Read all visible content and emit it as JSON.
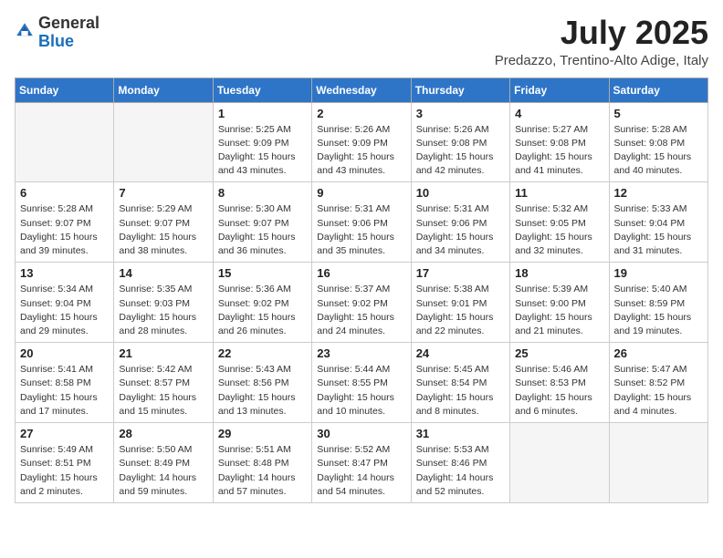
{
  "header": {
    "logo_general": "General",
    "logo_blue": "Blue",
    "title": "July 2025",
    "subtitle": "Predazzo, Trentino-Alto Adige, Italy"
  },
  "days_of_week": [
    "Sunday",
    "Monday",
    "Tuesday",
    "Wednesday",
    "Thursday",
    "Friday",
    "Saturday"
  ],
  "weeks": [
    [
      {
        "day": "",
        "empty": true
      },
      {
        "day": "",
        "empty": true
      },
      {
        "day": "1",
        "sunrise": "5:25 AM",
        "sunset": "9:09 PM",
        "daylight": "15 hours and 43 minutes."
      },
      {
        "day": "2",
        "sunrise": "5:26 AM",
        "sunset": "9:09 PM",
        "daylight": "15 hours and 43 minutes."
      },
      {
        "day": "3",
        "sunrise": "5:26 AM",
        "sunset": "9:08 PM",
        "daylight": "15 hours and 42 minutes."
      },
      {
        "day": "4",
        "sunrise": "5:27 AM",
        "sunset": "9:08 PM",
        "daylight": "15 hours and 41 minutes."
      },
      {
        "day": "5",
        "sunrise": "5:28 AM",
        "sunset": "9:08 PM",
        "daylight": "15 hours and 40 minutes."
      }
    ],
    [
      {
        "day": "6",
        "sunrise": "5:28 AM",
        "sunset": "9:07 PM",
        "daylight": "15 hours and 39 minutes."
      },
      {
        "day": "7",
        "sunrise": "5:29 AM",
        "sunset": "9:07 PM",
        "daylight": "15 hours and 38 minutes."
      },
      {
        "day": "8",
        "sunrise": "5:30 AM",
        "sunset": "9:07 PM",
        "daylight": "15 hours and 36 minutes."
      },
      {
        "day": "9",
        "sunrise": "5:31 AM",
        "sunset": "9:06 PM",
        "daylight": "15 hours and 35 minutes."
      },
      {
        "day": "10",
        "sunrise": "5:31 AM",
        "sunset": "9:06 PM",
        "daylight": "15 hours and 34 minutes."
      },
      {
        "day": "11",
        "sunrise": "5:32 AM",
        "sunset": "9:05 PM",
        "daylight": "15 hours and 32 minutes."
      },
      {
        "day": "12",
        "sunrise": "5:33 AM",
        "sunset": "9:04 PM",
        "daylight": "15 hours and 31 minutes."
      }
    ],
    [
      {
        "day": "13",
        "sunrise": "5:34 AM",
        "sunset": "9:04 PM",
        "daylight": "15 hours and 29 minutes."
      },
      {
        "day": "14",
        "sunrise": "5:35 AM",
        "sunset": "9:03 PM",
        "daylight": "15 hours and 28 minutes."
      },
      {
        "day": "15",
        "sunrise": "5:36 AM",
        "sunset": "9:02 PM",
        "daylight": "15 hours and 26 minutes."
      },
      {
        "day": "16",
        "sunrise": "5:37 AM",
        "sunset": "9:02 PM",
        "daylight": "15 hours and 24 minutes."
      },
      {
        "day": "17",
        "sunrise": "5:38 AM",
        "sunset": "9:01 PM",
        "daylight": "15 hours and 22 minutes."
      },
      {
        "day": "18",
        "sunrise": "5:39 AM",
        "sunset": "9:00 PM",
        "daylight": "15 hours and 21 minutes."
      },
      {
        "day": "19",
        "sunrise": "5:40 AM",
        "sunset": "8:59 PM",
        "daylight": "15 hours and 19 minutes."
      }
    ],
    [
      {
        "day": "20",
        "sunrise": "5:41 AM",
        "sunset": "8:58 PM",
        "daylight": "15 hours and 17 minutes."
      },
      {
        "day": "21",
        "sunrise": "5:42 AM",
        "sunset": "8:57 PM",
        "daylight": "15 hours and 15 minutes."
      },
      {
        "day": "22",
        "sunrise": "5:43 AM",
        "sunset": "8:56 PM",
        "daylight": "15 hours and 13 minutes."
      },
      {
        "day": "23",
        "sunrise": "5:44 AM",
        "sunset": "8:55 PM",
        "daylight": "15 hours and 10 minutes."
      },
      {
        "day": "24",
        "sunrise": "5:45 AM",
        "sunset": "8:54 PM",
        "daylight": "15 hours and 8 minutes."
      },
      {
        "day": "25",
        "sunrise": "5:46 AM",
        "sunset": "8:53 PM",
        "daylight": "15 hours and 6 minutes."
      },
      {
        "day": "26",
        "sunrise": "5:47 AM",
        "sunset": "8:52 PM",
        "daylight": "15 hours and 4 minutes."
      }
    ],
    [
      {
        "day": "27",
        "sunrise": "5:49 AM",
        "sunset": "8:51 PM",
        "daylight": "15 hours and 2 minutes."
      },
      {
        "day": "28",
        "sunrise": "5:50 AM",
        "sunset": "8:49 PM",
        "daylight": "14 hours and 59 minutes."
      },
      {
        "day": "29",
        "sunrise": "5:51 AM",
        "sunset": "8:48 PM",
        "daylight": "14 hours and 57 minutes."
      },
      {
        "day": "30",
        "sunrise": "5:52 AM",
        "sunset": "8:47 PM",
        "daylight": "14 hours and 54 minutes."
      },
      {
        "day": "31",
        "sunrise": "5:53 AM",
        "sunset": "8:46 PM",
        "daylight": "14 hours and 52 minutes."
      },
      {
        "day": "",
        "empty": true
      },
      {
        "day": "",
        "empty": true
      }
    ]
  ]
}
